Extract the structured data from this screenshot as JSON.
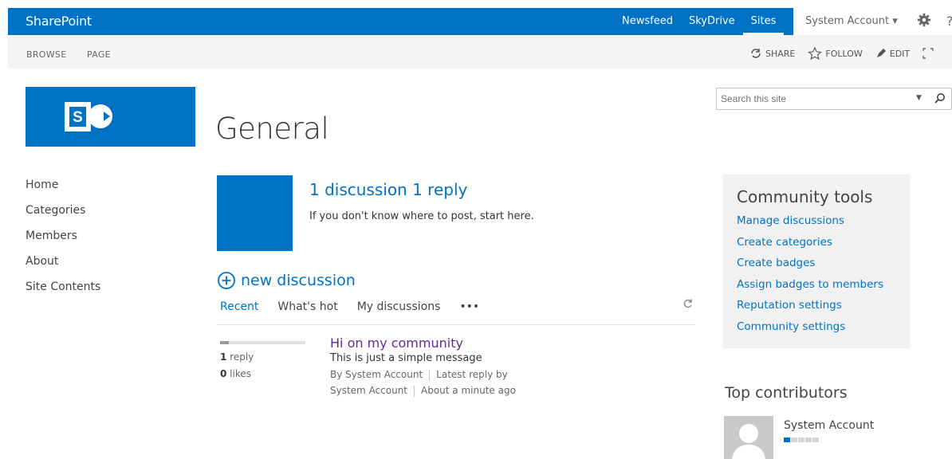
{
  "suitebar": {
    "brand": "SharePoint",
    "links": [
      "Newsfeed",
      "SkyDrive",
      "Sites"
    ],
    "active_link": "Sites",
    "account": "System Account ▾",
    "help_glyph": "?"
  },
  "ribbon": {
    "tabs": [
      "BROWSE",
      "PAGE"
    ],
    "actions": {
      "share": "SHARE",
      "follow": "FOLLOW",
      "edit": "EDIT"
    }
  },
  "page": {
    "title": "General"
  },
  "search": {
    "placeholder": "Search this site"
  },
  "nav": {
    "items": [
      "Home",
      "Categories",
      "Members",
      "About",
      "Site Contents"
    ]
  },
  "community": {
    "stats": "1 discussion 1 reply",
    "description": "If you don't know where to post, start here.",
    "new_discussion": "new discussion",
    "tabs": [
      "Recent",
      "What's hot",
      "My discussions",
      "•••"
    ],
    "active_tab": "Recent"
  },
  "discussion": {
    "title": "Hi on my community",
    "body": "This is just a simple message",
    "reply_count": "1",
    "reply_label": " reply",
    "like_count": "0",
    "like_label": " likes",
    "by_label": "By System Account",
    "latest_label": "Latest reply by",
    "latest_author": "System Account",
    "latest_time": "About a minute ago",
    "popularity": 0.1
  },
  "tools": {
    "title": "Community tools",
    "items": [
      "Manage discussions",
      "Create categories",
      "Create badges",
      "Assign badges to members",
      "Reputation settings",
      "Community settings"
    ]
  },
  "contributors": {
    "title": "Top contributors",
    "name": "System Account",
    "reputation_level": 1,
    "reputation_max": 5
  },
  "colors": {
    "accent": "#0072c6",
    "visited_link": "#5c2d91",
    "panel": "#f1f1f1"
  }
}
